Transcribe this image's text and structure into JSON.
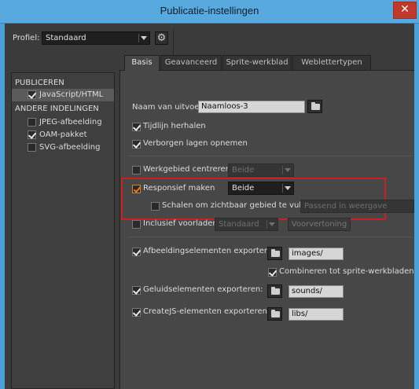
{
  "window": {
    "title": "Publicatie-instellingen",
    "close_glyph": "✕"
  },
  "profile": {
    "label": "Profiel:",
    "value": "Standaard"
  },
  "sidebar": {
    "publish_header": "PUBLICEREN",
    "items": [
      {
        "label": "JavaScript/HTML",
        "checked": true
      }
    ],
    "other_header": "ANDERE INDELINGEN",
    "other_items": [
      {
        "label": "JPEG-afbeelding",
        "checked": false
      },
      {
        "label": "OAM-pakket",
        "checked": true
      },
      {
        "label": "SVG-afbeelding",
        "checked": false
      }
    ]
  },
  "tabs": [
    {
      "label": "Basis",
      "active": true
    },
    {
      "label": "Geavanceerd",
      "active": false
    },
    {
      "label": "Sprite-werkblad",
      "active": false
    },
    {
      "label": "Weblettertypen",
      "active": false
    }
  ],
  "basis": {
    "output_name_label": "Naam van uitvoer:",
    "output_name_value": "Naamloos-3",
    "loop_timeline": "Tijdlijn herhalen",
    "hidden_layers": "Verborgen lagen opnemen",
    "center_stage": "Werkgebied centreren",
    "center_stage_option": "Beide",
    "responsive": "Responsief maken",
    "responsive_option": "Beide",
    "scale_visible": "Schalen om zichtbaar gebied te vullen",
    "scale_option": "Passend in weergave",
    "preloader": "Inclusief voorlader",
    "preloader_option": "Standaard",
    "preview_button": "Voorvertoning",
    "export_images": "Afbeeldingselementen exporteren:",
    "images_path": "images/",
    "combine_sprites": "Combineren tot sprite-werkbladen",
    "export_sounds": "Geluidselementen exporteren:",
    "sounds_path": "sounds/",
    "export_createjs": "CreateJS-elementen exporteren:",
    "libs_path": "libs/"
  },
  "colors": {
    "title_bar": "#58a9dd",
    "close_button": "#c0392b",
    "dialog_bg": "#3b3b3b",
    "highlight_box": "#cc1f1f",
    "checkbox_highlight": "#d9822b"
  },
  "icons": {
    "settings": "gear-icon",
    "folder": "folder-icon",
    "dropdown": "chevron-down-icon"
  }
}
